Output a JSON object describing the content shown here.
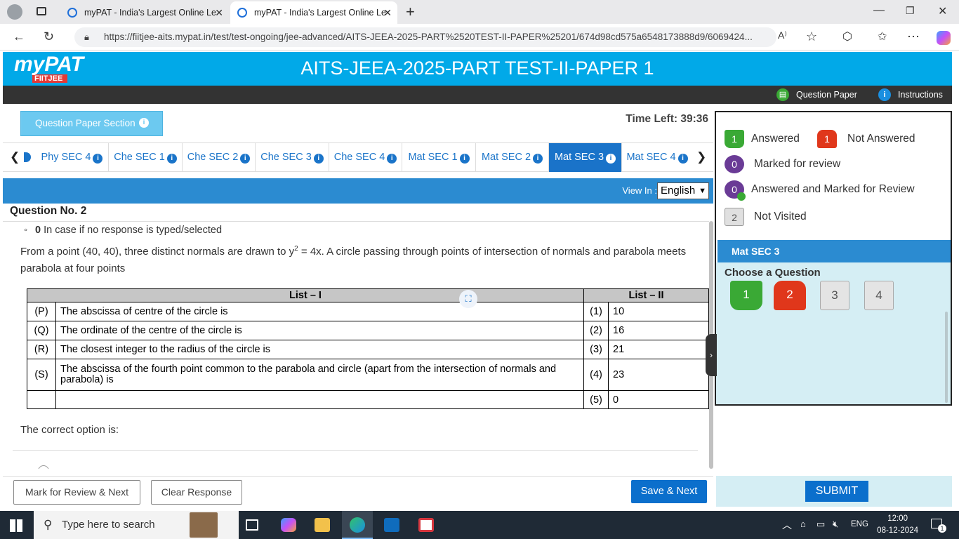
{
  "browser": {
    "tabs": [
      {
        "title": "myPAT - India's Largest Online Le"
      },
      {
        "title": "myPAT - India's Largest Online Le"
      }
    ],
    "url": "https://fiitjee-aits.mypat.in/test/test-ongoing/jee-advanced/AITS-JEEA-2025-PART%2520TEST-II-PAPER%25201/674d98cd575a6548173888d9/6069424..."
  },
  "app": {
    "logo_text": "myPAT",
    "logo_sub": "FIITJEE",
    "title": "AITS-JEEA-2025-PART TEST-II-PAPER 1",
    "question_paper_link": "Question Paper",
    "instructions_link": "Instructions",
    "section_button": "Question Paper Section",
    "time_left": "Time Left: 39:36",
    "section_tabs": [
      "Phy SEC 4",
      "Che SEC 1",
      "Che SEC 2",
      "Che SEC 3",
      "Che SEC 4",
      "Mat SEC 1",
      "Mat SEC 2",
      "Mat SEC 3",
      "Mat SEC 4"
    ],
    "active_tab": "Mat SEC 3",
    "view_in_label": "View In :",
    "language": "English",
    "question_number": "Question No. 2"
  },
  "question": {
    "bullet_bold": "0",
    "bullet_text": "In case if no response is typed/selected",
    "stem_a": "From a point (40, 40), three distinct normals are drawn to y",
    "stem_sup": "2",
    "stem_b": " = 4x. A circle passing through points of intersection of normals and parabola meets parabola at four points",
    "list_headers": [
      "List – I",
      "List – II"
    ],
    "rows": [
      {
        "label": "(P)",
        "text": "The abscissa of centre of the circle is",
        "num": "(1)",
        "val": "10"
      },
      {
        "label": "(Q)",
        "text": "The ordinate of the centre of the circle is",
        "num": "(2)",
        "val": "16"
      },
      {
        "label": "(R)",
        "text": "The closest integer to the radius of the circle is",
        "num": "(3)",
        "val": "21"
      },
      {
        "label": "(S)",
        "text": "The abscissa of the fourth point common to the parabola and circle (apart from the intersection of normals and parabola) is",
        "num": "(4)",
        "val": "23"
      },
      {
        "label": "",
        "text": "",
        "num": "(5)",
        "val": "0"
      }
    ],
    "correct_option": "The correct option is:"
  },
  "legend": {
    "answered": {
      "count": "1",
      "label": "Answered",
      "color": "#3aa935"
    },
    "not_answered": {
      "count": "1",
      "label": "Not Answered",
      "color": "#e0371b"
    },
    "marked": {
      "count": "0",
      "label": "Marked for review",
      "color": "#6a3b96"
    },
    "answered_marked": {
      "count": "0",
      "label": "Answered and Marked for Review",
      "color": "#6a3b96"
    },
    "not_visited": {
      "count": "2",
      "label": "Not Visited",
      "color": "#e0e0e0"
    }
  },
  "palette": {
    "section": "Mat SEC 3",
    "choose_label": "Choose a Question",
    "questions": [
      "1",
      "2",
      "3",
      "4"
    ]
  },
  "footer": {
    "mark_review": "Mark for Review & Next",
    "clear": "Clear Response",
    "save": "Save & Next",
    "submit": "SUBMIT"
  },
  "taskbar": {
    "search_placeholder": "Type here to search",
    "lang": "ENG",
    "time": "12:00",
    "date": "08-12-2024",
    "notif_count": "1"
  }
}
